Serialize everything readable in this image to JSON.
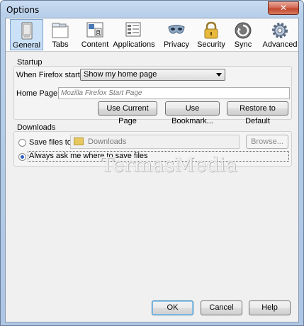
{
  "window": {
    "title": "Options",
    "close_label": "✕"
  },
  "toolbar": {
    "panes": [
      {
        "label": "General",
        "icon": "general-icon",
        "selected": true
      },
      {
        "label": "Tabs",
        "icon": "tabs-icon"
      },
      {
        "label": "Content",
        "icon": "content-icon"
      },
      {
        "label": "Applications",
        "icon": "applications-icon"
      },
      {
        "label": "Privacy",
        "icon": "privacy-mask-icon"
      },
      {
        "label": "Security",
        "icon": "padlock-icon"
      },
      {
        "label": "Sync",
        "icon": "sync-icon"
      },
      {
        "label": "Advanced",
        "icon": "gear-icon"
      }
    ]
  },
  "startup": {
    "title": "Startup",
    "when_label": "When Firefox starts:",
    "when_value": "Show my home page",
    "home_label": "Home Page:",
    "home_placeholder": "Mozilla Firefox Start Page",
    "use_current": "Use Current Page",
    "use_bookmark": "Use Bookmark...",
    "restore_default": "Restore to Default"
  },
  "downloads": {
    "title": "Downloads",
    "save_label": "Save files to",
    "folder": "Downloads",
    "browse": "Browse...",
    "always_ask": "Always ask me where to save files"
  },
  "watermark": "TermasMedia",
  "footer": {
    "ok": "OK",
    "cancel": "Cancel",
    "help": "Help"
  }
}
